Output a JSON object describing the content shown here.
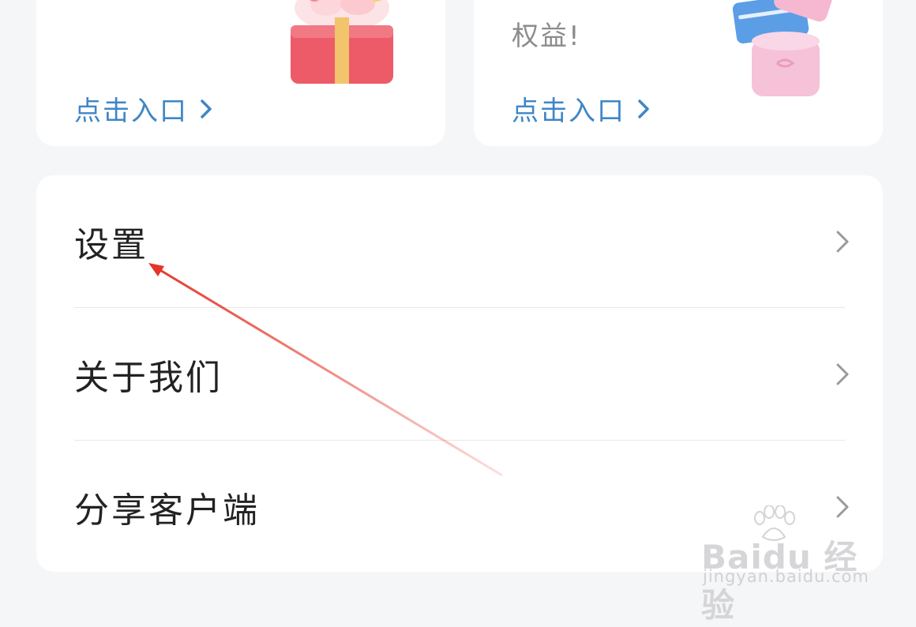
{
  "promo_cards": [
    {
      "link_label": "点击入口",
      "note": "",
      "illustration": "red-gift-box"
    },
    {
      "link_label": "点击入口",
      "note": "权益!",
      "illustration": "pink-card-box"
    }
  ],
  "menu": {
    "items": [
      {
        "label": "设置"
      },
      {
        "label": "关于我们"
      },
      {
        "label": "分享客户端"
      }
    ]
  },
  "watermark": {
    "brand": "Baidu 经验",
    "url": "jingyan.baidu.com"
  },
  "colors": {
    "background": "#f5f6f8",
    "card": "#ffffff",
    "link_blue": "#3f86c7",
    "annotation_red": "#e53528"
  },
  "annotation": {
    "type": "red-arrow",
    "target": "设置"
  }
}
